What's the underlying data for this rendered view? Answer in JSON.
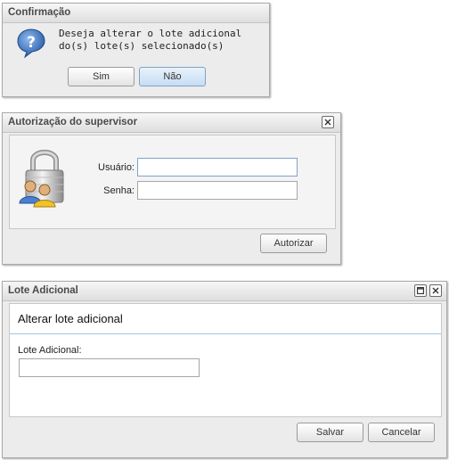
{
  "confirm": {
    "title": "Confirmação",
    "message": "Deseja alterar o lote adicional do(s) lote(s) selecionado(s)",
    "yes_label": "Sim",
    "no_label": "Não"
  },
  "auth": {
    "title": "Autorização do supervisor",
    "user_label": "Usuário:",
    "user_value": "",
    "pass_label": "Senha:",
    "pass_value": "",
    "authorize_label": "Autorizar"
  },
  "lote": {
    "title": "Lote Adicional",
    "heading": "Alterar lote adicional",
    "field_label": "Lote Adicional:",
    "field_value": "",
    "save_label": "Salvar",
    "cancel_label": "Cancelar"
  },
  "colors": {
    "accent": "#7fa3c8",
    "question_icon": "#2a5fa8",
    "divider": "#a7c3dc"
  },
  "icons": [
    "question-icon",
    "lock-users-icon",
    "close-icon",
    "maximize-icon"
  ]
}
